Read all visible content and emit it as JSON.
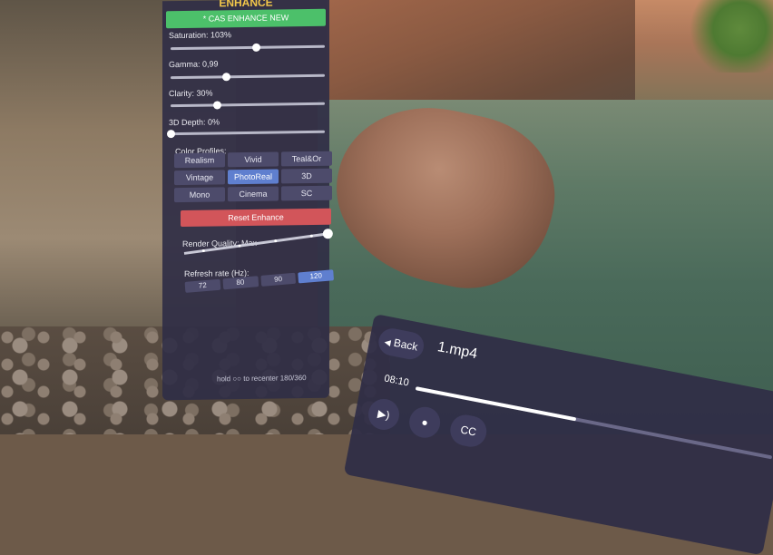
{
  "enhance_panel": {
    "title": "ENHANCE",
    "cas_button": "* CAS ENHANCE NEW",
    "sliders": [
      {
        "label": "Saturation: 103%",
        "value": 0.55
      },
      {
        "label": "Gamma: 0,99",
        "value": 0.36
      },
      {
        "label": "Clarity: 30%",
        "value": 0.3
      },
      {
        "label": "3D Depth: 0%",
        "value": 0.0
      }
    ],
    "color_profiles_label": "Color Profiles:",
    "profiles": [
      "Realism",
      "Vivid",
      "Teal&Or",
      "Vintage",
      "PhotoReal",
      "3D",
      "Mono",
      "Cinema",
      "SC"
    ],
    "active_profile": "PhotoReal",
    "reset_button": "Reset Enhance",
    "render_quality_label": "Render Quality: Max",
    "refresh_rate_label": "Refresh rate (Hz):",
    "refresh_rates": [
      "72",
      "80",
      "90",
      "120"
    ],
    "active_refresh_rate": "120",
    "recenter_hint": "hold ○○ to recenter 180/360"
  },
  "player": {
    "back_label": "Back",
    "back_icon": "triangle-left-icon",
    "filename": "1.mp4",
    "time": "08:10",
    "progress": 0.45,
    "cc_label": "CC",
    "controls": [
      "audio-icon",
      "stop-icon",
      "cc-icon"
    ]
  },
  "colors": {
    "panel_bg": "#302e46",
    "title_gold": "#f3c84a",
    "cas_green": "#4cc06a",
    "reset_red": "#d2555a",
    "active_blue": "#5f7fcf"
  }
}
